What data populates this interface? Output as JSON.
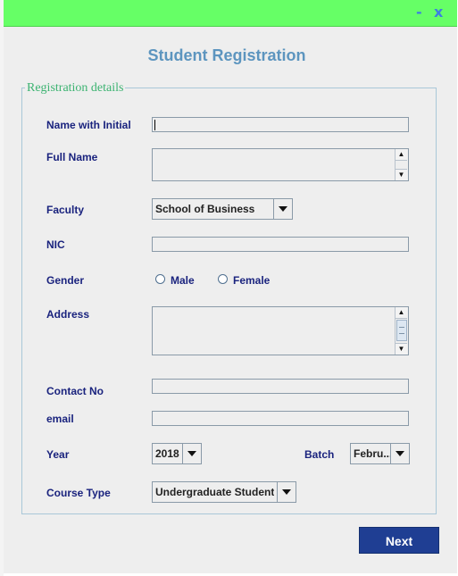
{
  "titlebar": {
    "minimize": "-",
    "close": "x"
  },
  "form": {
    "heading": "Student Registration",
    "group_title": "Registration details",
    "labels": {
      "name_with_initial": "Name with Initial",
      "full_name": "Full Name",
      "faculty": "Faculty",
      "nic": "NIC",
      "gender": "Gender",
      "address": "Address",
      "contact_no": "Contact No",
      "email": "email",
      "year": "Year",
      "batch": "Batch",
      "course_type": "Course Type"
    },
    "values": {
      "name_with_initial": "",
      "full_name": "",
      "nic": "",
      "address": "",
      "contact_no": "",
      "email": ""
    },
    "faculty_selected": "School of Business",
    "gender_options": [
      "Male",
      "Female"
    ],
    "year_selected": "2018",
    "batch_selected": "Febru...",
    "course_type_selected": "Undergraduate Student",
    "next_button": "Next"
  }
}
